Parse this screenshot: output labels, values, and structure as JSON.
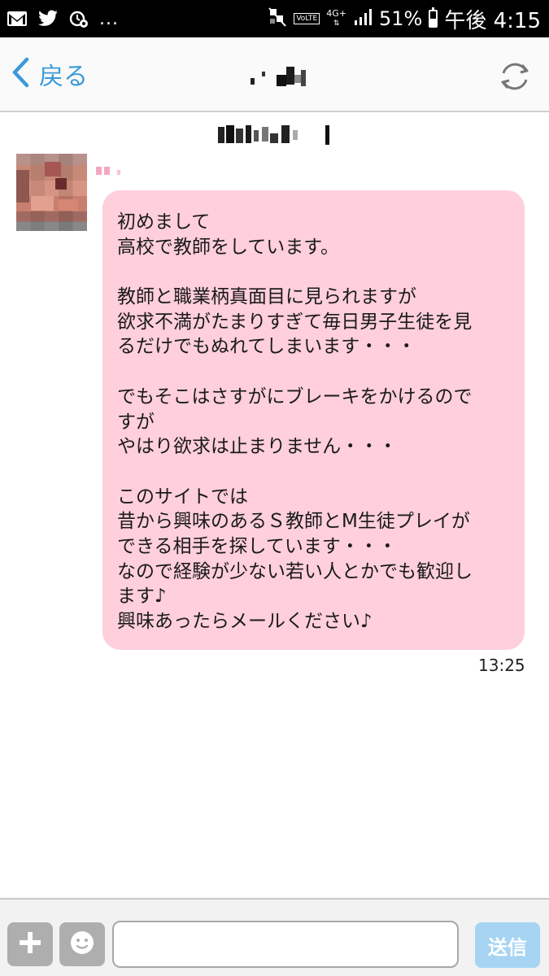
{
  "status_bar": {
    "icons": [
      "gmail-icon",
      "twitter-icon",
      "alarm-settings-icon"
    ],
    "more": "...",
    "network_badge": "VoLTE",
    "network_type": "4G+",
    "battery_percent": "51%",
    "battery_level": 0.51,
    "time": "午後 4:15"
  },
  "header": {
    "back_label": "戻る",
    "reload_icon": "reload-icon",
    "accent_color": "#3a9ad9"
  },
  "message": {
    "lines": [
      "初めまして",
      "高校で教師をしています。",
      "",
      "教師と職業柄真面目に見られますが",
      "欲求不満がたまりすぎて毎日男子生徒を見",
      "るだけでもぬれてしまいます・・・",
      "",
      "でもそこはさすがにブレーキをかけるので",
      "すが",
      "やはり欲求は止まりません・・・",
      "",
      "このサイトでは",
      "昔から興味のあるＳ教師とM生徒プレイが",
      "できる相手を探しています・・・",
      "なので経験が少ない若い人とかでも歓迎し",
      "ます♪",
      "興味あったらメールください♪"
    ],
    "time": "13:25",
    "bubble_color": "#ffcfdc"
  },
  "input_bar": {
    "add_icon": "plus-icon",
    "emoji_icon": "smiley-icon",
    "input_value": "",
    "send_label": "送信"
  }
}
